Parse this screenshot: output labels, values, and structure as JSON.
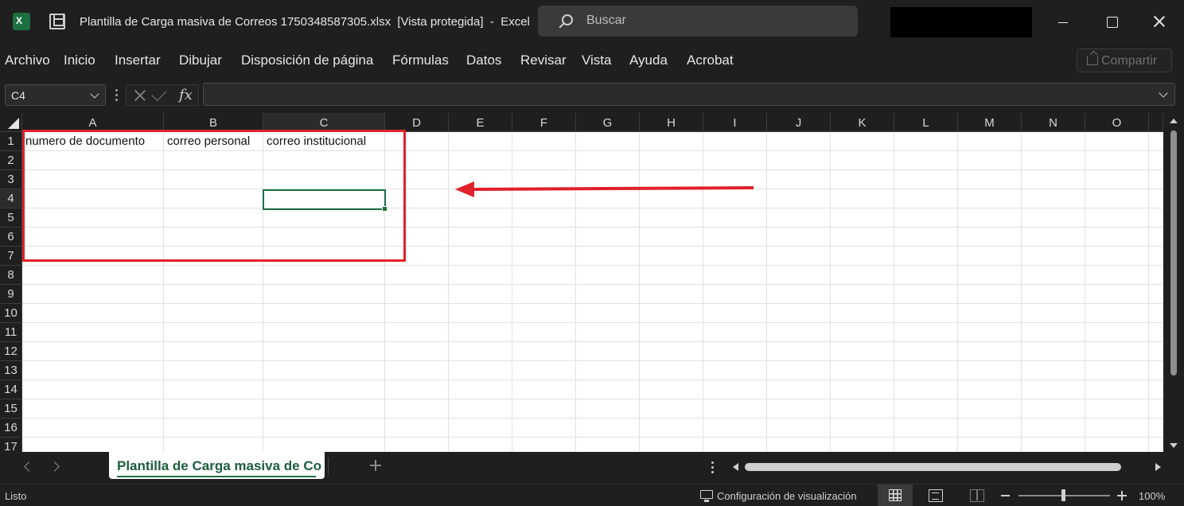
{
  "titlebar": {
    "app_icon_letter": "X",
    "title": "Plantilla de Carga masiva de Correos 1750348587305.xlsx  [Vista protegida]  -  Excel",
    "search_placeholder": "Buscar"
  },
  "menu": {
    "items": [
      "Archivo",
      "Inicio",
      "Insertar",
      "Dibujar",
      "Disposición de página",
      "Fórmulas",
      "Datos",
      "Revisar",
      "Vista",
      "Ayuda",
      "Acrobat"
    ],
    "share_label": "Compartir"
  },
  "formula_bar": {
    "name_box": "C4",
    "fx_label": "fx",
    "formula": ""
  },
  "sheet": {
    "columns": [
      "A",
      "B",
      "C",
      "D",
      "E",
      "F",
      "G",
      "H",
      "I",
      "J",
      "K",
      "L",
      "M",
      "N",
      "O"
    ],
    "active_column": "C",
    "rows": [
      "1",
      "2",
      "3",
      "4",
      "5",
      "6",
      "7",
      "8",
      "9",
      "10",
      "11",
      "12",
      "13",
      "14",
      "15",
      "16",
      "17"
    ],
    "active_row": "4",
    "cells": {
      "A1": "numero de documento",
      "B1": "correo personal",
      "C1": "correo institucional"
    },
    "selected_cell": "C4"
  },
  "annotation": {
    "color": "#e0212b"
  },
  "sheet_tabs": {
    "active_tab_label": "Plantilla de Carga masiva de Co"
  },
  "status_bar": {
    "status": "Listo",
    "display_settings": "Configuración de visualización",
    "zoom": "100%"
  },
  "colors": {
    "accent": "#1d6f42",
    "background": "#1f1f1f",
    "grid_background": "#ffffff"
  }
}
